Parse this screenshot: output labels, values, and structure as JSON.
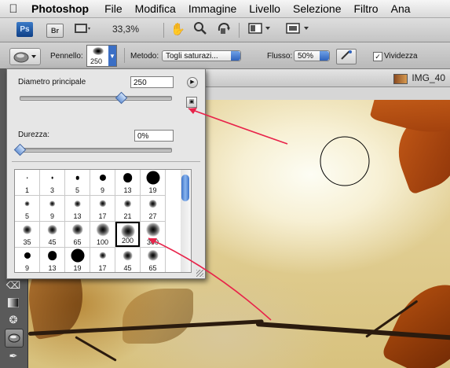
{
  "menubar": {
    "apple": "",
    "items": [
      "Photoshop",
      "File",
      "Modifica",
      "Immagine",
      "Livello",
      "Selezione",
      "Filtro",
      "Ana"
    ]
  },
  "appbar": {
    "ps_logo": "Ps",
    "br_label": "Br",
    "zoom": "33,3%",
    "icons": [
      "film-icon",
      "hand-icon",
      "zoom-icon",
      "rotate-view-icon",
      "arrange-documents-icon",
      "screen-mode-icon"
    ]
  },
  "options": {
    "brush_label": "Pennello:",
    "brush_size": "250",
    "metodo_label": "Metodo:",
    "metodo_value": "Togli saturazi...",
    "flusso_label": "Flusso:",
    "flusso_value": "50%",
    "vividezza_label": "Vividezza",
    "vividezza_checked": "✓"
  },
  "document": {
    "title": "IMG_40"
  },
  "brush_panel": {
    "diametro_label": "Diametro principale",
    "diametro_value": "250",
    "diametro_fraction": 0.67,
    "durezza_label": "Durezza:",
    "durezza_value": "0%",
    "durezza_fraction": 0.0,
    "selected_preset": "200",
    "presets": [
      {
        "size": "1",
        "kind": "hard"
      },
      {
        "size": "3",
        "kind": "hard"
      },
      {
        "size": "5",
        "kind": "hard"
      },
      {
        "size": "9",
        "kind": "hard"
      },
      {
        "size": "13",
        "kind": "hard"
      },
      {
        "size": "19",
        "kind": "hard"
      },
      {
        "size": "5",
        "kind": "soft"
      },
      {
        "size": "9",
        "kind": "soft"
      },
      {
        "size": "13",
        "kind": "soft"
      },
      {
        "size": "17",
        "kind": "soft"
      },
      {
        "size": "21",
        "kind": "soft"
      },
      {
        "size": "27",
        "kind": "soft"
      },
      {
        "size": "35",
        "kind": "soft"
      },
      {
        "size": "45",
        "kind": "soft"
      },
      {
        "size": "65",
        "kind": "soft"
      },
      {
        "size": "100",
        "kind": "soft"
      },
      {
        "size": "200",
        "kind": "soft"
      },
      {
        "size": "300",
        "kind": "soft"
      },
      {
        "size": "9",
        "kind": "hard"
      },
      {
        "size": "13",
        "kind": "hard"
      },
      {
        "size": "19",
        "kind": "hard"
      },
      {
        "size": "17",
        "kind": "soft"
      },
      {
        "size": "45",
        "kind": "soft"
      },
      {
        "size": "65",
        "kind": "soft"
      }
    ]
  },
  "annotations": {
    "arrow_color": "#e8234a"
  }
}
